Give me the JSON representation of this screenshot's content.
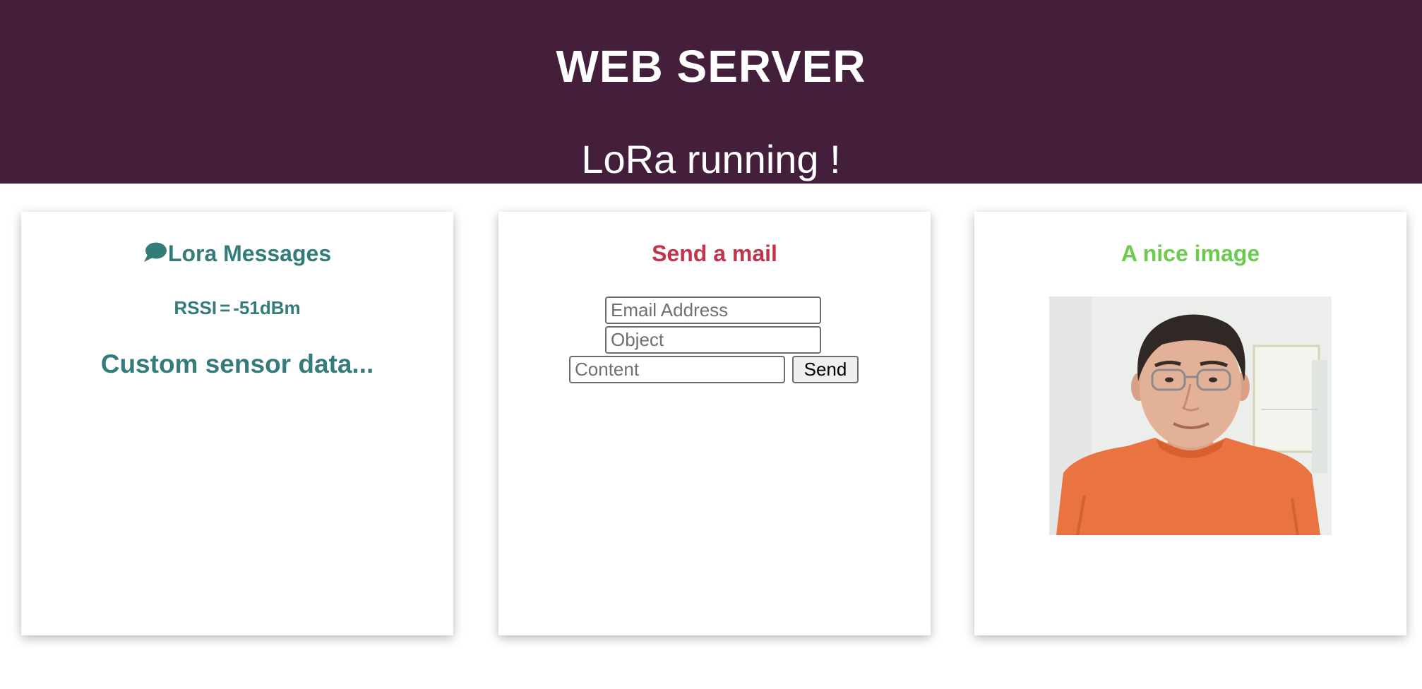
{
  "header": {
    "title": "WEB SERVER",
    "subtitle": "LoRa running !",
    "background_color": "#431f3c"
  },
  "lora_card": {
    "icon": "chat-bubble-icon",
    "title": "Lora Messages",
    "rssi_label": "RSSI",
    "rssi_separator": "=",
    "rssi_value": "-51dBm",
    "sensor_text": "Custom sensor data...",
    "accent_color": "#347c7a"
  },
  "mail_card": {
    "title": "Send a mail",
    "email_placeholder": "Email Address",
    "object_placeholder": "Object",
    "content_placeholder": "Content",
    "send_label": "Send",
    "accent_color": "#c2344b"
  },
  "image_card": {
    "title": "A nice image",
    "image_subject": "portrait of a man in an orange t-shirt",
    "accent_color": "#6ccb4e"
  }
}
